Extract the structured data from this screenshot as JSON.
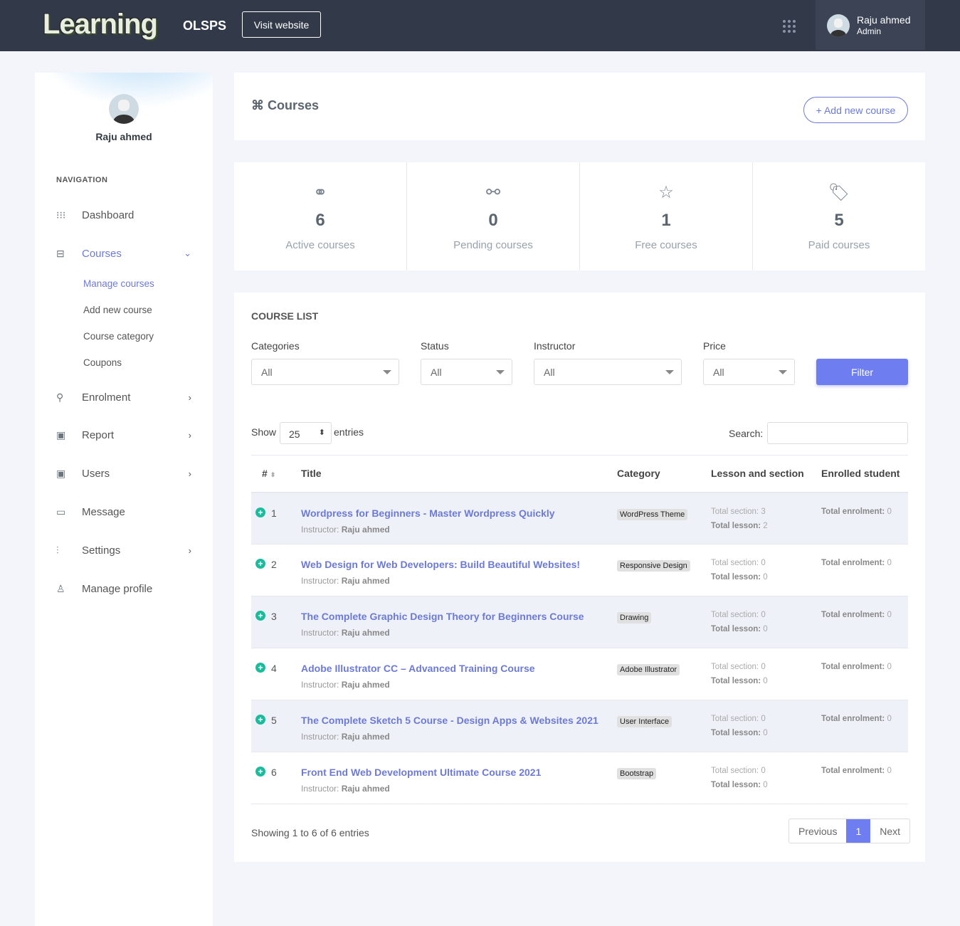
{
  "header": {
    "logo": "Learning",
    "brand": "OLSPS",
    "visit": "Visit website",
    "user": "Raju ahmed",
    "role": "Admin"
  },
  "sidebar": {
    "user": "Raju ahmed",
    "nav_label": "NAVIGATION",
    "items": [
      {
        "label": "Dashboard",
        "icon": "⁝⁝⁝",
        "chev": ""
      },
      {
        "label": "Courses",
        "icon": "⊟",
        "chev": "⌄"
      },
      {
        "label": "Enrolment",
        "icon": "⚲",
        "chev": "›"
      },
      {
        "label": "Report",
        "icon": "▣",
        "chev": "›"
      },
      {
        "label": "Users",
        "icon": "▣",
        "chev": "›"
      },
      {
        "label": "Message",
        "icon": "▭",
        "chev": ""
      },
      {
        "label": "Settings",
        "icon": "⫶",
        "chev": "›"
      },
      {
        "label": "Manage profile",
        "icon": "♙",
        "chev": ""
      }
    ],
    "sub": [
      "Manage courses",
      "Add new course",
      "Course category",
      "Coupons"
    ]
  },
  "page": {
    "title": "Courses",
    "icon": "⌘",
    "add": "+ Add new course"
  },
  "stats": [
    {
      "icon": "⚭",
      "value": "6",
      "label": "Active courses"
    },
    {
      "icon": "⚯",
      "value": "0",
      "label": "Pending courses"
    },
    {
      "icon": "☆",
      "value": "1",
      "label": "Free courses"
    },
    {
      "icon": "🏷",
      "value": "5",
      "label": "Paid courses"
    }
  ],
  "list": {
    "heading": "COURSE LIST",
    "filters": [
      {
        "label": "Categories",
        "value": "All"
      },
      {
        "label": "Status",
        "value": "All"
      },
      {
        "label": "Instructor",
        "value": "All"
      },
      {
        "label": "Price",
        "value": "All"
      }
    ],
    "filter_btn": "Filter",
    "show": "Show",
    "entries_value": "25",
    "entries": "entries",
    "search": "Search:",
    "columns": [
      "#",
      "Title",
      "Category",
      "Lesson and section",
      "Enrolled student"
    ],
    "instr_label": "Instructor:",
    "section_label": "Total section:",
    "lesson_label": "Total lesson:",
    "enrol_label": "Total enrolment:",
    "rows": [
      {
        "n": "1",
        "title": "Wordpress for Beginners - Master Wordpress Quickly",
        "instructor": "Raju ahmed",
        "category": "WordPress Theme",
        "sections": "3",
        "lessons": "2",
        "enrolment": "0"
      },
      {
        "n": "2",
        "title": "Web Design for Web Developers: Build Beautiful Websites!",
        "instructor": "Raju ahmed",
        "category": "Responsive Design",
        "sections": "0",
        "lessons": "0",
        "enrolment": "0"
      },
      {
        "n": "3",
        "title": "The Complete Graphic Design Theory for Beginners Course",
        "instructor": "Raju ahmed",
        "category": "Drawing",
        "sections": "0",
        "lessons": "0",
        "enrolment": "0"
      },
      {
        "n": "4",
        "title": "Adobe Illustrator CC – Advanced Training Course",
        "instructor": "Raju ahmed",
        "category": "Adobe Illustrator",
        "sections": "0",
        "lessons": "0",
        "enrolment": "0"
      },
      {
        "n": "5",
        "title": "The Complete Sketch 5 Course - Design Apps & Websites 2021",
        "instructor": "Raju ahmed",
        "category": "User Interface",
        "sections": "0",
        "lessons": "0",
        "enrolment": "0"
      },
      {
        "n": "6",
        "title": "Front End Web Development Ultimate Course 2021",
        "instructor": "Raju ahmed",
        "category": "Bootstrap",
        "sections": "0",
        "lessons": "0",
        "enrolment": "0"
      }
    ],
    "footer": "Showing 1 to 6 of 6 entries",
    "prev": "Previous",
    "page": "1",
    "next": "Next"
  }
}
